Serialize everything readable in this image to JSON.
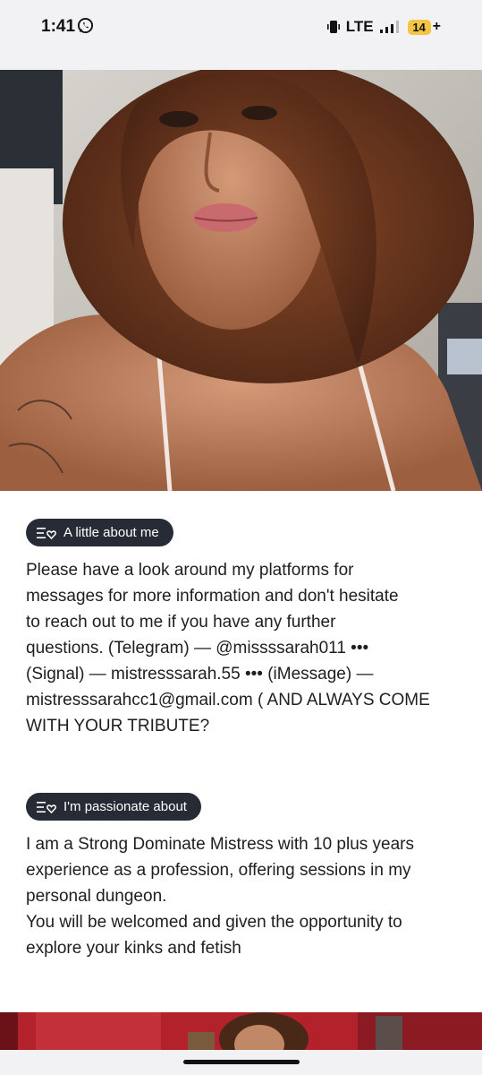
{
  "status_bar": {
    "time": "1:41",
    "network": "LTE",
    "battery": "14",
    "battery_suffix": "+",
    "icons": [
      "whatsapp-icon",
      "vibrate-icon",
      "signal-icon",
      "battery-icon"
    ]
  },
  "hero_image": {
    "icon": "profile-photo"
  },
  "sections": [
    {
      "chip_label": "A little about me",
      "chip_icon": "list-heart-icon",
      "text": "Please have a look around my platforms for\nmessages for more information and don't hesitate\nto reach out to me if you have any further\nquestions.   (Telegram) — @missssarah011  •••\n(Signal) —  mistresssarah.55 ••• (iMessage) —\nmistresssarahcc1@gmail.com ( AND ALWAYS COME\nWITH YOUR TRIBUTE?"
    },
    {
      "chip_label": "I'm passionate about",
      "chip_icon": "list-heart-icon",
      "text": "I am a Strong Dominate Mistress with 10 plus years\nexperience as a profession, offering sessions in my\npersonal dungeon.\nYou will be welcomed and given the opportunity to\nexplore your kinks and fetish"
    }
  ],
  "colors": {
    "chip_bg": "#262b36",
    "text": "#1e1e1e",
    "battery": "#f4c542",
    "status_bg": "#f2f2f4"
  }
}
